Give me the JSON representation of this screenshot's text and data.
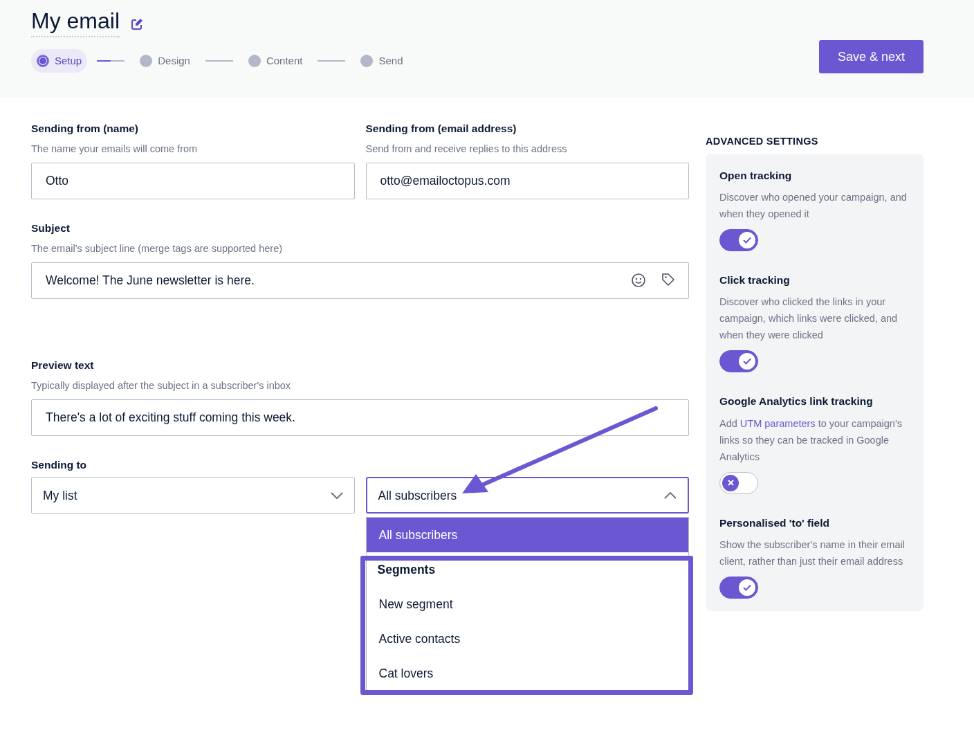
{
  "header": {
    "title": "My email",
    "steps": [
      {
        "label": "Setup",
        "selected": true
      },
      {
        "label": "Design",
        "selected": false
      },
      {
        "label": "Content",
        "selected": false
      },
      {
        "label": "Send",
        "selected": false
      }
    ],
    "save_button": "Save & next"
  },
  "form": {
    "fields": [
      {
        "label": "Sending from (name)",
        "hint": "The name your emails will come from",
        "value": "Otto"
      },
      {
        "label": "Sending from (email address)",
        "hint": "Send from and receive replies to this address",
        "value": "otto@emailoctopus.com"
      }
    ],
    "subject": {
      "label": "Subject",
      "hint": "The email's subject line (merge tags are supported here)",
      "value": "Welcome! The June newsletter is here."
    },
    "preview": {
      "label": "Preview text",
      "hint": "Typically displayed after the subject in a subscriber's inbox",
      "value": "There's a lot of exciting stuff coming this week."
    },
    "sending_to": {
      "label": "Sending to",
      "list_select": {
        "value": "My list",
        "expanded": false
      },
      "segment_select": {
        "value": "All subscribers",
        "expanded": true,
        "options": [
          {
            "kind": "option",
            "label": "All subscribers",
            "selected": true
          },
          {
            "kind": "group",
            "label": "Segments"
          },
          {
            "kind": "option",
            "label": "New segment",
            "selected": false
          },
          {
            "kind": "option",
            "label": "Active contacts",
            "selected": false
          },
          {
            "kind": "option",
            "label": "Cat lovers",
            "selected": false
          }
        ]
      }
    }
  },
  "advanced": {
    "heading": "ADVANCED SETTINGS",
    "settings": [
      {
        "title": "Open tracking",
        "description": [
          {
            "kind": "text",
            "text": "Discover who opened your campaign, and when they opened it"
          }
        ],
        "on": true
      },
      {
        "title": "Click tracking",
        "description": [
          {
            "kind": "text",
            "text": "Discover who clicked the links in your campaign, which links were clicked, and when they were clicked"
          }
        ],
        "on": true
      },
      {
        "title": "Google Analytics link tracking",
        "description": [
          {
            "kind": "text",
            "text": "Add "
          },
          {
            "kind": "link",
            "text": "UTM parameters"
          },
          {
            "kind": "text",
            "text": " to your campaign's links so they can be tracked in Google Analytics"
          }
        ],
        "on": false
      },
      {
        "title": "Personalised 'to' field",
        "description": [
          {
            "kind": "text",
            "text": "Show the subscriber's name in their email client, rather than just their email address"
          }
        ],
        "on": true
      }
    ]
  }
}
